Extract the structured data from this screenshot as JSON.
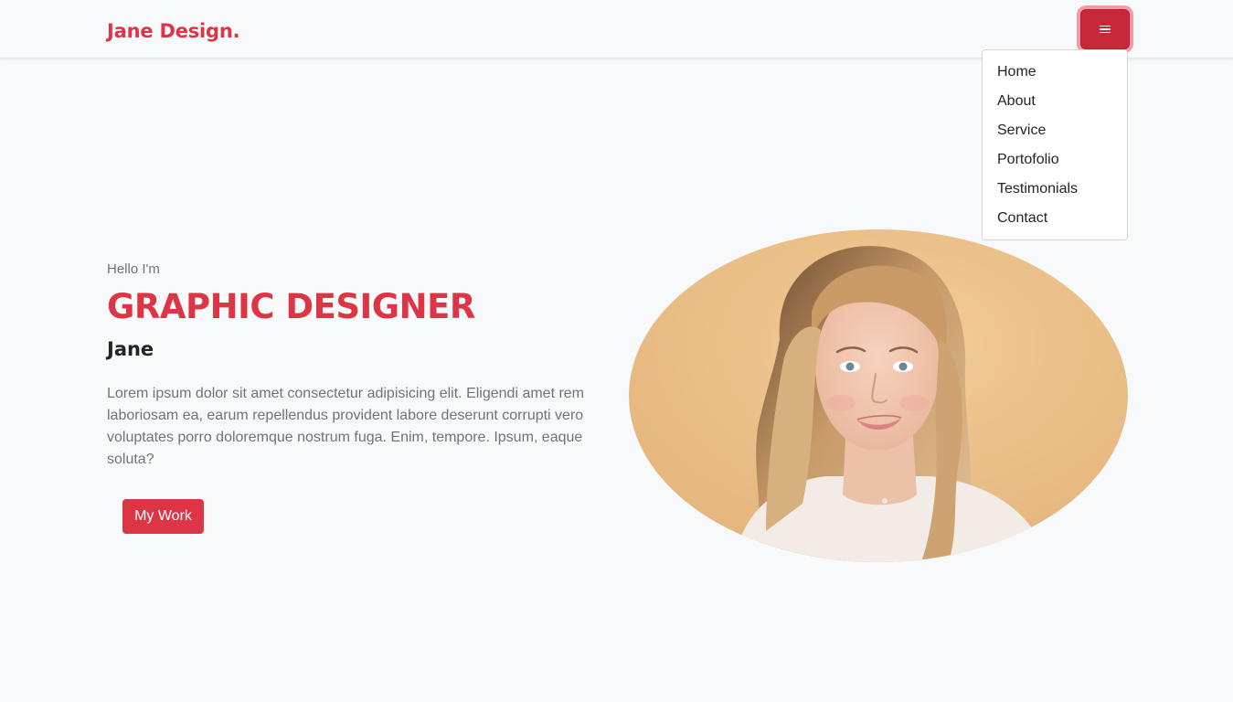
{
  "navbar": {
    "brand": "Jane Design.",
    "menu": [
      "Home",
      "About",
      "Service",
      "Portofolio",
      "Testimonials",
      "Contact"
    ]
  },
  "hero": {
    "greeting": "Hello I'm",
    "title": "GRAPHIC DESIGNER",
    "name": "Jane",
    "bio": "Lorem ipsum dolor sit amet consectetur adipisicing elit. Eligendi amet rem laboriosam ea, earum repellendus provident labore deserunt corrupti vero voluptates porro doloremque nostrum fuga. Enim, tempore. Ipsum, eaque soluta?",
    "cta_label": "My Work"
  },
  "icons": {
    "toggler": "hamburger-menu-icon"
  },
  "colors": {
    "accent": "#dc3545",
    "background": "#f8f9fa",
    "muted_text": "#6c757d",
    "dark_text": "#212529",
    "portrait_background": "#ecc38d"
  }
}
